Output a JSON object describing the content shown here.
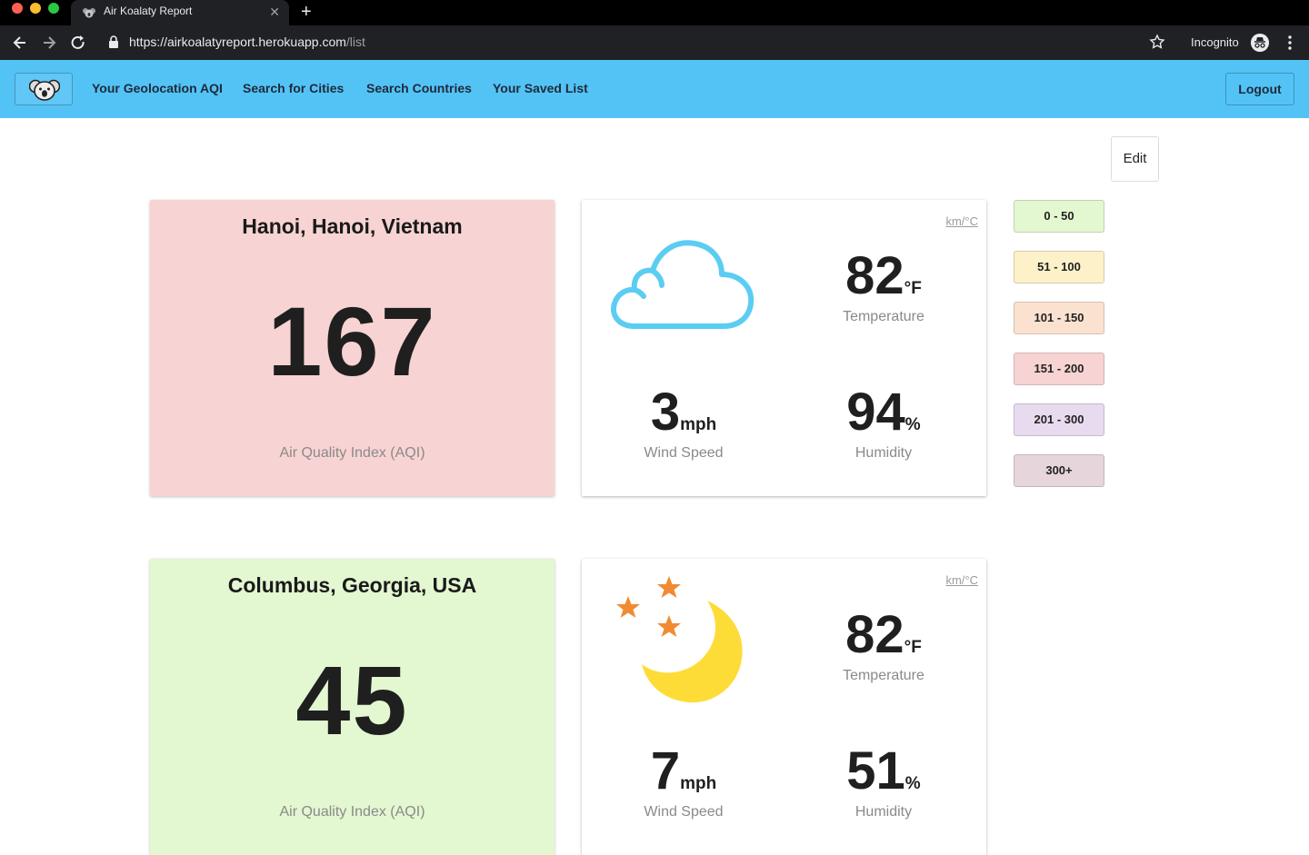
{
  "browser": {
    "tab_title": "Air Koalaty Report",
    "url_host": "https://airkoalatyreport.herokuapp.com",
    "url_path": "/list",
    "incognito_label": "Incognito",
    "new_tab_glyph": "+",
    "close_glyph": "✕"
  },
  "nav": {
    "links": [
      "Your Geolocation AQI",
      "Search for Cities",
      "Search Countries",
      "Your Saved List"
    ],
    "logout": "Logout",
    "logo_icon": "koala-logo-icon"
  },
  "content": {
    "edit_label": "Edit",
    "cities": [
      {
        "name": "Hanoi, Hanoi, Vietnam",
        "aqi": "167",
        "aqi_label": "Air Quality Index (AQI)",
        "aqi_color": "#f8d3d3",
        "weather_icon": "cloud-icon",
        "unit_toggle": "km/°C",
        "temperature": "82",
        "temperature_unit": "°F",
        "temperature_label": "Temperature",
        "wind": "3",
        "wind_unit": "mph",
        "wind_label": "Wind Speed",
        "humidity": "94",
        "humidity_unit": "%",
        "humidity_label": "Humidity"
      },
      {
        "name": "Columbus, Georgia, USA",
        "aqi": "45",
        "aqi_label": "Air Quality Index (AQI)",
        "aqi_color": "#e3f7d1",
        "weather_icon": "moon-stars-icon",
        "unit_toggle": "km/°C",
        "temperature": "82",
        "temperature_unit": "°F",
        "temperature_label": "Temperature",
        "wind": "7",
        "wind_unit": "mph",
        "wind_label": "Wind Speed",
        "humidity": "51",
        "humidity_unit": "%",
        "humidity_label": "Humidity"
      }
    ],
    "legend": [
      {
        "label": "0 - 50",
        "color": "#e3f7d1"
      },
      {
        "label": "51 - 100",
        "color": "#fdf1c9"
      },
      {
        "label": "101 - 150",
        "color": "#fbe2d0"
      },
      {
        "label": "151 - 200",
        "color": "#f8d3d3"
      },
      {
        "label": "201 - 300",
        "color": "#e8dbef"
      },
      {
        "label": "300+",
        "color": "#e6d6dc"
      }
    ]
  },
  "colors": {
    "navbar": "#53c3f6",
    "cloud_stroke": "#5bcdf3",
    "moon": "#fddc37",
    "stars": "#f08b33"
  }
}
